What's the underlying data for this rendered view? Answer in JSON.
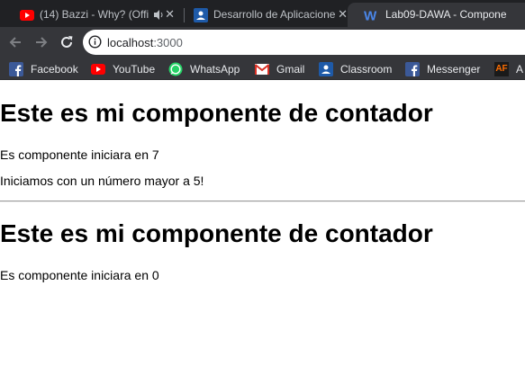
{
  "tabs": [
    {
      "title": "(14) Bazzi - Why? (Offi",
      "icon": "youtube-icon",
      "muted": true,
      "active": false
    },
    {
      "title": "Desarrollo de Aplicacione",
      "icon": "classroom-icon",
      "active": false
    },
    {
      "title": "Lab09-DAWA - Compone",
      "icon": "word-icon",
      "active": true
    }
  ],
  "omnibox": {
    "host": "localhost",
    "port": ":3000"
  },
  "bookmarks": [
    {
      "label": "Facebook",
      "icon": "facebook-icon"
    },
    {
      "label": "YouTube",
      "icon": "youtube-icon"
    },
    {
      "label": "WhatsApp",
      "icon": "whatsapp-icon"
    },
    {
      "label": "Gmail",
      "icon": "gmail-icon"
    },
    {
      "label": "Classroom",
      "icon": "classroom-icon"
    },
    {
      "label": "Messenger",
      "icon": "facebook-icon"
    },
    {
      "label": "A",
      "icon": "af-icon",
      "icon_text": "AF"
    }
  ],
  "content": {
    "counter1": {
      "heading": "Este es mi componente de contador",
      "start_text": "Es componente iniciara en 7",
      "extra_text": "Iniciamos con un número mayor a 5!"
    },
    "counter2": {
      "heading": "Este es mi componente de contador",
      "start_text": "Es componente iniciara en 0"
    }
  },
  "colors": {
    "tabstrip_bg": "#202124",
    "toolbar_bg": "#35363a",
    "youtube_red": "#ff0000",
    "facebook_blue": "#3b5998",
    "whatsapp_green": "#25d366",
    "classroom_blue": "#1e5aa8",
    "word_blue": "#2b579a"
  }
}
